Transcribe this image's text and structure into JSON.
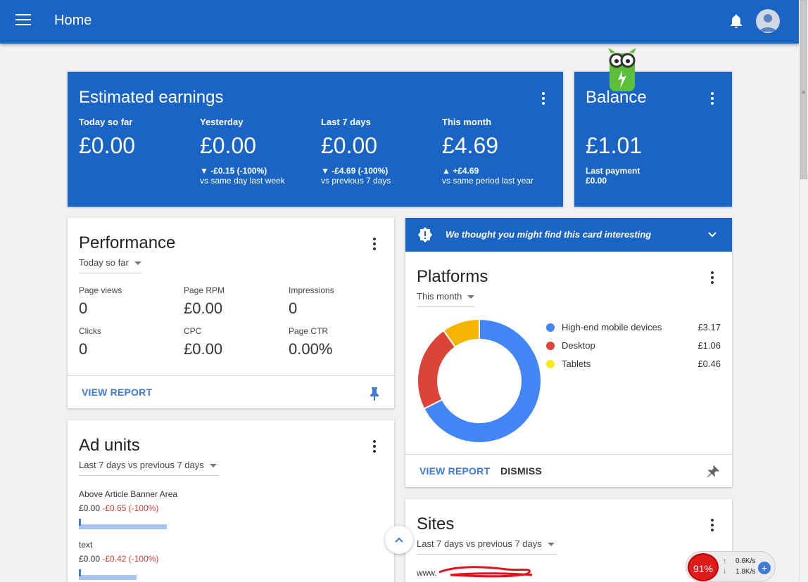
{
  "header": {
    "title": "Home"
  },
  "earnings": {
    "title": "Estimated earnings",
    "metrics": [
      {
        "label": "Today so far",
        "value": "£0.00",
        "change": "",
        "compare": ""
      },
      {
        "label": "Yesterday",
        "value": "£0.00",
        "change": "▼ -£0.15 (-100%)",
        "compare": "vs same day last week"
      },
      {
        "label": "Last 7 days",
        "value": "£0.00",
        "change": "▼ -£4.69 (-100%)",
        "compare": "vs previous 7 days"
      },
      {
        "label": "This month",
        "value": "£4.69",
        "change": "▲ +£4.69",
        "compare": "vs same period last year"
      }
    ]
  },
  "balance": {
    "title": "Balance",
    "value": "£1.01",
    "last_payment_label": "Last payment",
    "last_payment_value": "£0.00"
  },
  "performance": {
    "title": "Performance",
    "range": "Today so far",
    "stats": [
      {
        "label": "Page views",
        "value": "0"
      },
      {
        "label": "Page RPM",
        "value": "£0.00"
      },
      {
        "label": "Impressions",
        "value": "0"
      },
      {
        "label": "Clicks",
        "value": "0"
      },
      {
        "label": "CPC",
        "value": "£0.00"
      },
      {
        "label": "Page CTR",
        "value": "0.00%"
      }
    ],
    "view_report": "VIEW REPORT"
  },
  "notice": {
    "text": "We thought you might find this card interesting"
  },
  "platforms": {
    "title": "Platforms",
    "range": "This month",
    "view_report": "VIEW REPORT",
    "dismiss": "DISMISS"
  },
  "chart_data": {
    "type": "pie",
    "categories": [
      "High-end mobile devices",
      "Desktop",
      "Tablets"
    ],
    "values": [
      3.17,
      1.06,
      0.46
    ],
    "labels": [
      "£3.17",
      "£1.06",
      "£0.46"
    ],
    "colors": [
      "#4285f4",
      "#db4437",
      "#f4b400"
    ],
    "legend_colors": [
      "#4285f4",
      "#db4437",
      "#fbe91d"
    ],
    "legend": "right"
  },
  "ad_units": {
    "title": "Ad units",
    "range": "Last 7 days vs previous 7 days",
    "items": [
      {
        "name": "Above Article Banner Area",
        "value": "£0.00",
        "change": "-£0.65 (-100%)"
      },
      {
        "name": "text",
        "value": "£0.00",
        "change": "-£0.42 (-100%)"
      }
    ]
  },
  "sites": {
    "title": "Sites",
    "range": "Last 7 days vs previous 7 days",
    "first_site": "www."
  },
  "widget": {
    "percent": "91%",
    "up": "0.6K/s",
    "down": "1.8K/s"
  }
}
